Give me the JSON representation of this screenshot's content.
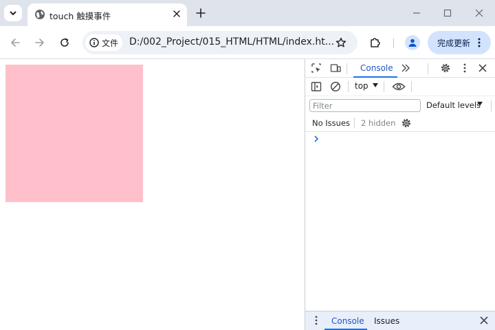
{
  "browser": {
    "tab": {
      "title": "touch 触摸事件",
      "favicon": "globe-icon"
    },
    "omnibox": {
      "security_chip": "文件",
      "url": "D:/002_Project/015_HTML/HTML/index.ht..."
    },
    "update_button": "完成更新"
  },
  "page": {
    "box_color": "#ffc0cb"
  },
  "devtools": {
    "tabs": [
      "Console"
    ],
    "context": "top",
    "filter_placeholder": "Filter",
    "levels": "Default levels",
    "issues": {
      "status": "No Issues",
      "hidden": "2 hidden"
    },
    "drawer_tabs": {
      "console": "Console",
      "issues": "Issues"
    }
  },
  "colors": {
    "accent": "#1a73e8",
    "tabstrip": "#dfe3eb",
    "update_bg": "#d3e3fd"
  }
}
